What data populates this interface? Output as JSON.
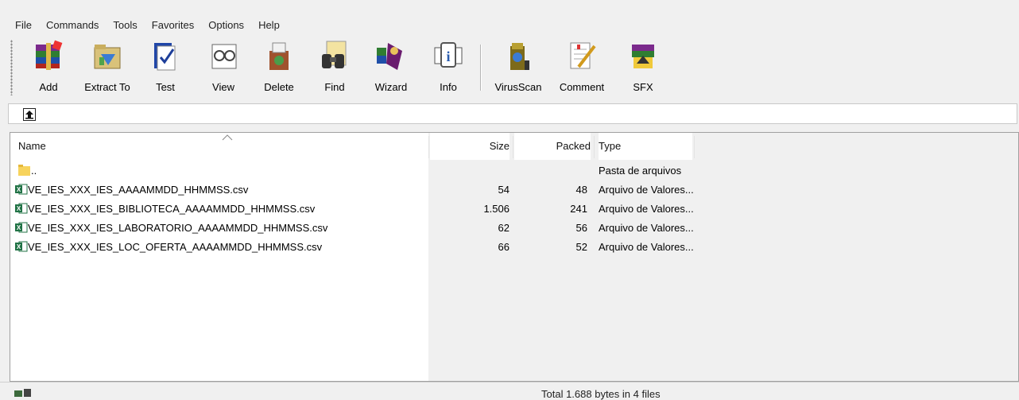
{
  "menu": [
    {
      "label": "File"
    },
    {
      "label": "Commands"
    },
    {
      "label": "Tools"
    },
    {
      "label": "Favorites"
    },
    {
      "label": "Options"
    },
    {
      "label": "Help"
    }
  ],
  "toolbar": {
    "buttons": [
      {
        "label": "Add",
        "icon": "add-archive-icon"
      },
      {
        "label": "Extract To",
        "icon": "extract-icon"
      },
      {
        "label": "Test",
        "icon": "test-icon"
      },
      {
        "label": "View",
        "icon": "view-icon"
      },
      {
        "label": "Delete",
        "icon": "delete-icon"
      },
      {
        "label": "Find",
        "icon": "find-icon"
      },
      {
        "label": "Wizard",
        "icon": "wizard-icon"
      },
      {
        "label": "Info",
        "icon": "info-icon"
      },
      {
        "label": "VirusScan",
        "icon": "virus-scan-icon"
      },
      {
        "label": "Comment",
        "icon": "comment-icon"
      },
      {
        "label": "SFX",
        "icon": "sfx-icon"
      }
    ]
  },
  "list": {
    "columns": {
      "name": "Name",
      "size": "Size",
      "packed": "Packed",
      "type": "Type"
    },
    "rows": [
      {
        "name": "..",
        "size": "",
        "packed": "",
        "type": "Pasta de arquivos",
        "kind": "folder"
      },
      {
        "name": "VE_IES_XXX_IES_AAAAMMDD_HHMMSS.csv",
        "size": "54",
        "packed": "48",
        "type": "Arquivo de Valores...",
        "kind": "csv"
      },
      {
        "name": "VE_IES_XXX_IES_BIBLIOTECA_AAAAMMDD_HHMMSS.csv",
        "size": "1.506",
        "packed": "241",
        "type": "Arquivo de Valores...",
        "kind": "csv"
      },
      {
        "name": "VE_IES_XXX_IES_LABORATORIO_AAAAMMDD_HHMMSS.csv",
        "size": "62",
        "packed": "56",
        "type": "Arquivo de Valores...",
        "kind": "csv"
      },
      {
        "name": "VE_IES_XXX_IES_LOC_OFERTA_AAAAMMDD_HHMMSS.csv",
        "size": "66",
        "packed": "52",
        "type": "Arquivo de Valores...",
        "kind": "csv"
      }
    ]
  },
  "status": {
    "text": "Total 1.688 bytes in 4 files"
  }
}
